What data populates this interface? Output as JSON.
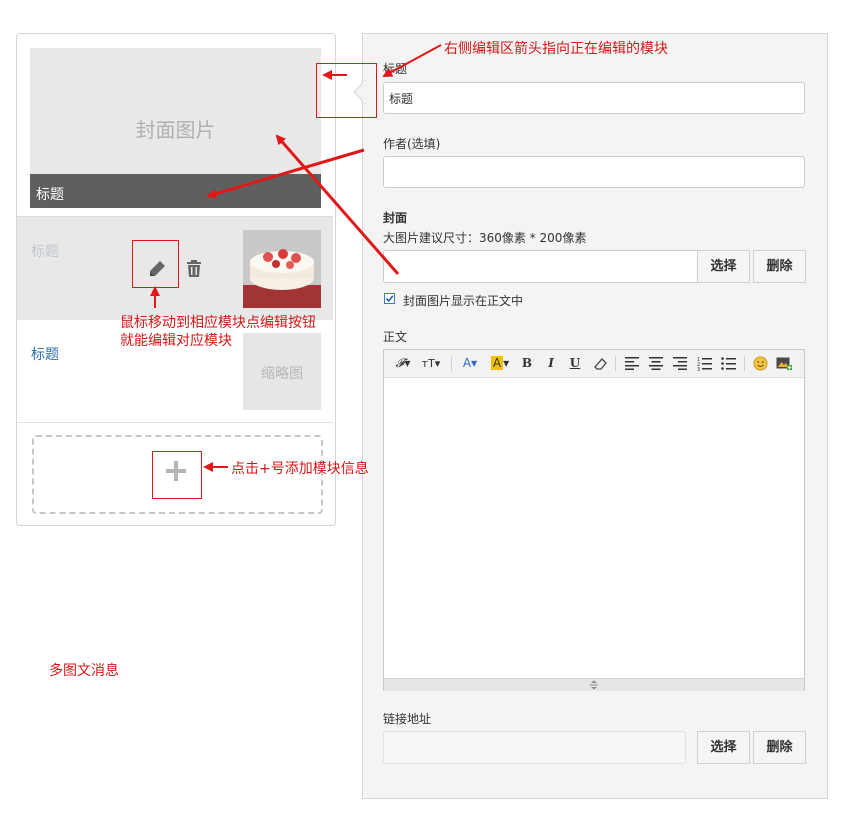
{
  "preview": {
    "cover_placeholder": "封面图片",
    "cover_title": "标题",
    "items": [
      {
        "title": "标题"
      },
      {
        "title": "标题",
        "thumb_placeholder": "缩略图"
      }
    ]
  },
  "annotations": {
    "arrow_note": "右侧编辑区箭头指向正在编辑的模块",
    "edit_note_line1": "鼠标移动到相应模块点编辑按钮",
    "edit_note_line2": "就能编辑对应模块",
    "add_note": "点击+号添加模块信息",
    "caption": "多图文消息"
  },
  "form": {
    "title_label": "标题",
    "title_value": "标题",
    "author_label": "作者(选填)",
    "author_value": "",
    "cover_label": "封面",
    "cover_hint": "大图片建议尺寸：360像素 * 200像素",
    "cover_select": "选择",
    "cover_delete": "删除",
    "show_cover_label": "封面图片显示在正文中",
    "show_cover_checked": true,
    "body_label": "正文",
    "link_label": "链接地址",
    "link_value": "",
    "link_select": "选择",
    "link_delete": "删除"
  },
  "toolbar_icons": [
    "font-family-icon",
    "font-size-icon",
    "font-color-icon",
    "highlight-icon",
    "bold-icon",
    "italic-icon",
    "underline-icon",
    "eraser-icon",
    "align-left-icon",
    "align-center-icon",
    "align-right-icon",
    "ordered-list-icon",
    "unordered-list-icon",
    "emoji-icon",
    "image-icon"
  ],
  "colors": {
    "annotation": "#d41818",
    "link": "#2f6fb0",
    "cover_bar": "#5f5f5f"
  }
}
